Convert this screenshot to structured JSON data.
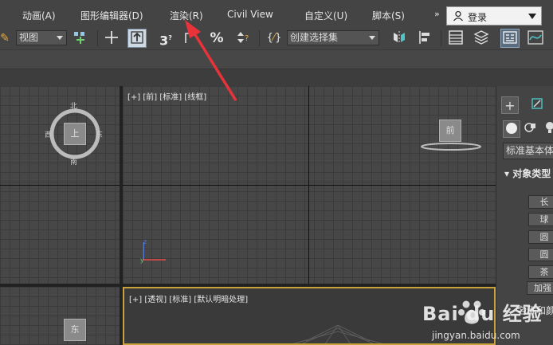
{
  "menu": {
    "items": [
      {
        "label": "动画(A)"
      },
      {
        "label": "图形编辑器(D)"
      },
      {
        "label": "渲染(R)"
      },
      {
        "label": "Civil View"
      },
      {
        "label": "自定义(U)"
      },
      {
        "label": "脚本(S)"
      }
    ],
    "more": "»",
    "login": "登录"
  },
  "toolbar": {
    "view_select": "视图",
    "selection_set": "创建选择集"
  },
  "viewports": {
    "top_left_label": "",
    "front_label": "[+] [前] [标准] [线框]",
    "perspective_label": "[+] [透视] [标准] [默认明暗处理]",
    "viewcube_top_face": "上",
    "viewcube_front_face": "前",
    "viewcube_bottom_face": "东",
    "compass_north": "北",
    "compass_south": "南",
    "compass_east": "东",
    "compass_west": "西"
  },
  "command_panel": {
    "dropdown": "标准基本体",
    "rollout_title": "对象类型",
    "buttons": [
      "长",
      "球",
      "圆",
      "圆",
      "茶"
    ],
    "extra_button": "加强",
    "name_color_label": "名称和颜"
  },
  "watermark": {
    "brand": "Bai du 经验",
    "url": "jingyan.baidu.com"
  },
  "annotation": {
    "arrow_color": "#e8333a"
  }
}
